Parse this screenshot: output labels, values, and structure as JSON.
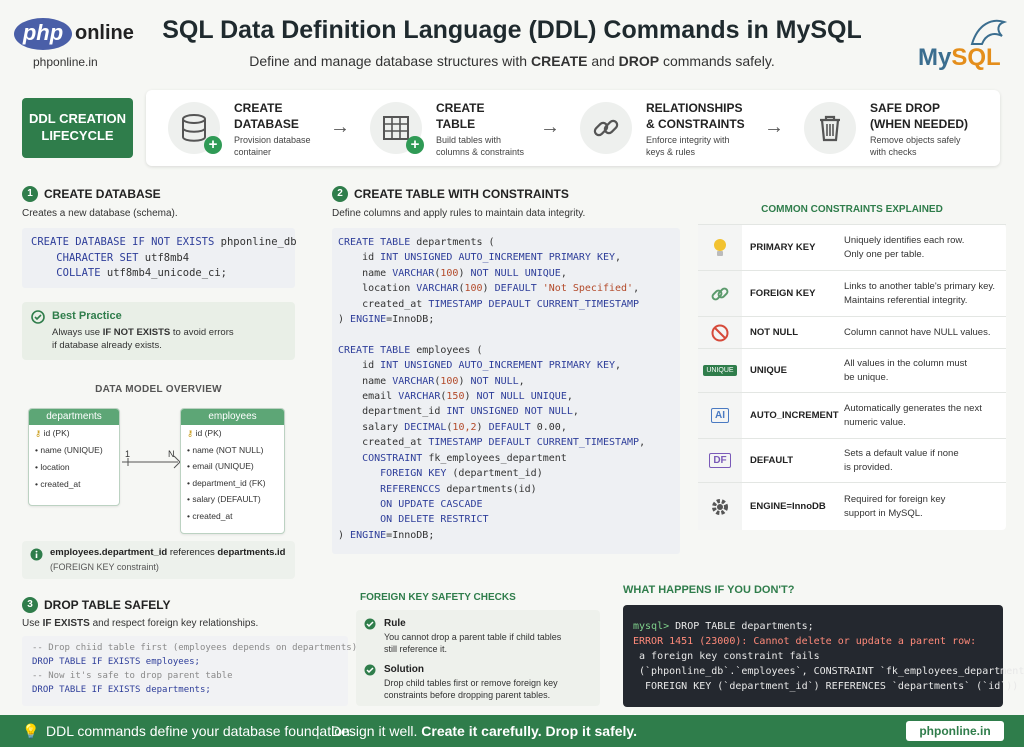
{
  "brand": {
    "logo_php": "php",
    "logo_online": "online",
    "site": "phponline.in"
  },
  "header": {
    "title": "SQL Data Definition Language (DDL) Commands in MySQL",
    "subtitle_pre": "Define and manage database structures with ",
    "subtitle_create": "CREATE",
    "subtitle_and": " and ",
    "subtitle_drop": "DROP",
    "subtitle_post": " commands safely.",
    "mysql_my": "My",
    "mysql_sql": "SQL"
  },
  "lifecycle": {
    "badge_line1": "DDL CREATION",
    "badge_line2": "LIFECYCLE",
    "steps": [
      {
        "title1": "CREATE",
        "title2": "DATABASE",
        "desc1": "Provision database",
        "desc2": "container",
        "icon": "database-icon"
      },
      {
        "title1": "CREATE",
        "title2": "TABLE",
        "desc1": "Build tables with",
        "desc2": "columns & constraints",
        "icon": "table-icon"
      },
      {
        "title1": "RELATIONSHIPS",
        "title2": "& CONSTRAINTS",
        "desc1": "Enforce integrity with",
        "desc2": "keys & rules",
        "icon": "link-icon"
      },
      {
        "title1": "SAFE DROP",
        "title2": "(WHEN NEEDED)",
        "desc1": "Remove objects safely",
        "desc2": "with checks",
        "icon": "trash-icon"
      }
    ]
  },
  "sec1": {
    "num": "1",
    "title": "CREATE DATABASE",
    "desc": "Creates a new database (schema).",
    "code": [
      "CREATE DATABASE IF NOT EXISTS phponline_db",
      "    CHARACTER SET utf8mb4",
      "    COLLATE utf8mb4_unicode_ci;"
    ],
    "bp_title": "Best Practice",
    "bp_pre": "Always use ",
    "bp_kw": "IF NOT EXISTS",
    "bp_post": " to avoid errors",
    "bp_line2": "if database already exists."
  },
  "model": {
    "title": "DATA MODEL OVERVIEW",
    "departments": {
      "name": "departments",
      "rows": [
        "id (PK)",
        "name (UNIQUE)",
        "location",
        "created_at"
      ]
    },
    "employees": {
      "name": "employees",
      "rows": [
        "id (PK)",
        "name (NOT NULL)",
        "email (UNIQUE)",
        "department_id (FK)",
        "salary (DEFAULT)",
        "created_at"
      ]
    },
    "card_one": "1",
    "card_n": "N",
    "note_bold1": "employees.department_id",
    "note_mid": " references ",
    "note_bold2": "departments.id",
    "note_line2": "(FOREIGN KEY constraint)"
  },
  "sec2": {
    "num": "2",
    "title": "CREATE TABLE WITH CONSTRAINTS",
    "desc": "Define columns and apply rules to maintain data integrity.",
    "code": [
      "CREATE TABLE departments (",
      "    id INT UNSIGNED AUTO_INCREMENT PRIMARY KEY,",
      "    name VARCHAR(100) NOT NULL UNIQUE,",
      "    location VARCHAR(100) DEFAULT 'Not Specified',",
      "    created_at TIMESTAMP DEPAULT CURRENT_TIMESTAMP",
      ") ENGINE=InnoDB;",
      "",
      "CREATE TABLE employees (",
      "    id INT UNSIGNED AUTO_INCREMENT PRIMARY KEY,",
      "    name VARCHAR(100) NOT NULL,",
      "    email VARCHAR(150) NOT NULL UNIQUE,",
      "    department_id INT UNSIGNED NOT NULL,",
      "    salary DECIMAL(10,2) DEFAULT 0.00,",
      "    created_at TIMESTAMP DEFAULT CURRENT_TIMESTAMP,",
      "    CONSTRAINT fk_employees_department",
      "       FOREIGN KEY (department_id)",
      "       REFERENCCS departments(id)",
      "       ON UPDATE CASCADE",
      "       ON DELETE RESTRICT",
      ") ENGINE=InnoDB;"
    ]
  },
  "constraints": {
    "title": "COMMON CONSTRAINTS EXPLAINED",
    "rows": [
      {
        "name": "PRIMARY KEY",
        "d1": "Uniquely identifies each row.",
        "d2": "Only one per table.",
        "icon": "lightbulb-icon"
      },
      {
        "name": "FOREIGN KEY",
        "d1": "Links to another table's primary key.",
        "d2": "Maintains referential integrity.",
        "icon": "link-icon"
      },
      {
        "name": "NOT NULL",
        "d1": "Column cannot have NULL values.",
        "d2": "",
        "icon": "prohibited-icon"
      },
      {
        "name": "UNIQUE",
        "d1": "All values in the column must",
        "d2": "be unique.",
        "icon": "unique-badge-icon",
        "badge": "UNIQUE"
      },
      {
        "name": "AUTO_INCREMENT",
        "d1": "Automatically generates the next",
        "d2": "numeric value.",
        "icon": "ai-icon",
        "badge": "AI"
      },
      {
        "name": "DEFAULT",
        "d1": "Sets a default value if none",
        "d2": "is provided.",
        "icon": "df-icon",
        "badge": "DF"
      },
      {
        "name": "ENGINE=InnoDB",
        "d1": "Required for foreign key",
        "d2": "support in MySQL.",
        "icon": "gear-icon"
      }
    ]
  },
  "sec3": {
    "num": "3",
    "title": "DROP TABLE SAFELY",
    "desc_pre": "Use ",
    "desc_kw": "IF EXISTS",
    "desc_post": " and respect foreign key relationships.",
    "code": [
      "-- Drop chiid table first (employees depends on departments)",
      "DROP TABLE IF EXISTS employees;",
      "",
      "-- Now it's safe to drop parent table",
      "DROP TABLE IF EXISTS departments;"
    ]
  },
  "fk_checks": {
    "title": "FOREIGN KEY SAFETY CHECKS",
    "rule_title": "Rule",
    "rule_1": "You cannot drop a parent table if child tables",
    "rule_2": "still reference it.",
    "sol_title": "Solution",
    "sol_1": "Drop child tables first or remove foreign key",
    "sol_2": "constraints before dropping parent tables."
  },
  "what_happens": {
    "title": "WHAT HAPPENS IF YOU DON'T?",
    "lines": [
      "mysql> DROP TABLE departments;",
      "ERROR 1451 (23000): Cannot delete or update a parent row:",
      " a foreign key constraint fails",
      " (`phponline_db`.`employees`, CONSTRAINT `fk_employees_department`",
      "  FOREIGN KEY (`department_id`) REFERENCES `departments` (`id`))"
    ]
  },
  "footer": {
    "text1": "DDL commands define your database foundation.",
    "sep": "|",
    "text2": "Design it well.",
    "text3": "Create it carefully. Drop it safely.",
    "site": "phponline.in"
  }
}
